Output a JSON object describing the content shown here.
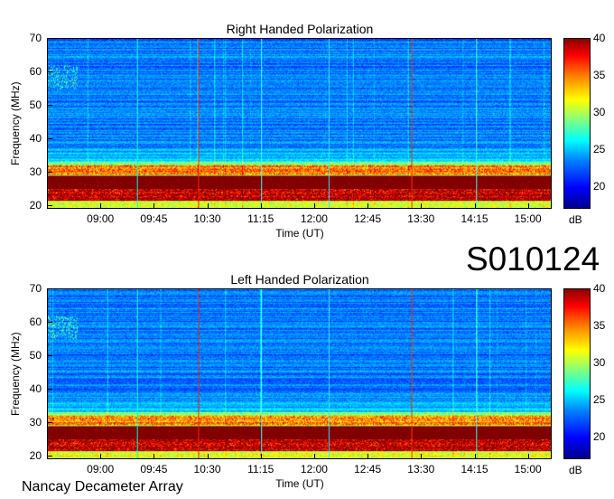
{
  "station_code": "S010124",
  "footer": "Nancay Decameter Array",
  "colorbar": {
    "unit": "dB",
    "ticks": [
      "40",
      "35",
      "30",
      "25",
      "20"
    ]
  },
  "chart_data": [
    {
      "type": "heatmap",
      "title": "Right Handed Polarization",
      "xlabel": "Time (UT)",
      "ylabel": "Frequency (MHz)",
      "x_ticks": [
        "09:00",
        "09:45",
        "10:30",
        "11:15",
        "12:00",
        "12:45",
        "13:30",
        "14:15",
        "15:00"
      ],
      "y_ticks": [
        "70",
        "60",
        "50",
        "40",
        "30",
        "20"
      ],
      "ylim": [
        19,
        70
      ],
      "clim": [
        17,
        40
      ],
      "x_range": [
        "08:15",
        "15:20"
      ],
      "colormap": "jet"
    },
    {
      "type": "heatmap",
      "title": "Left Handed Polarization",
      "xlabel": "Time (UT)",
      "ylabel": "Frequency (MHz)",
      "x_ticks": [
        "09:00",
        "09:45",
        "10:30",
        "11:15",
        "12:00",
        "12:45",
        "13:30",
        "14:15",
        "15:00"
      ],
      "y_ticks": [
        "70",
        "60",
        "50",
        "40",
        "30",
        "20"
      ],
      "ylim": [
        19,
        70
      ],
      "clim": [
        17,
        40
      ],
      "x_range": [
        "08:15",
        "15:20"
      ],
      "colormap": "jet"
    }
  ]
}
